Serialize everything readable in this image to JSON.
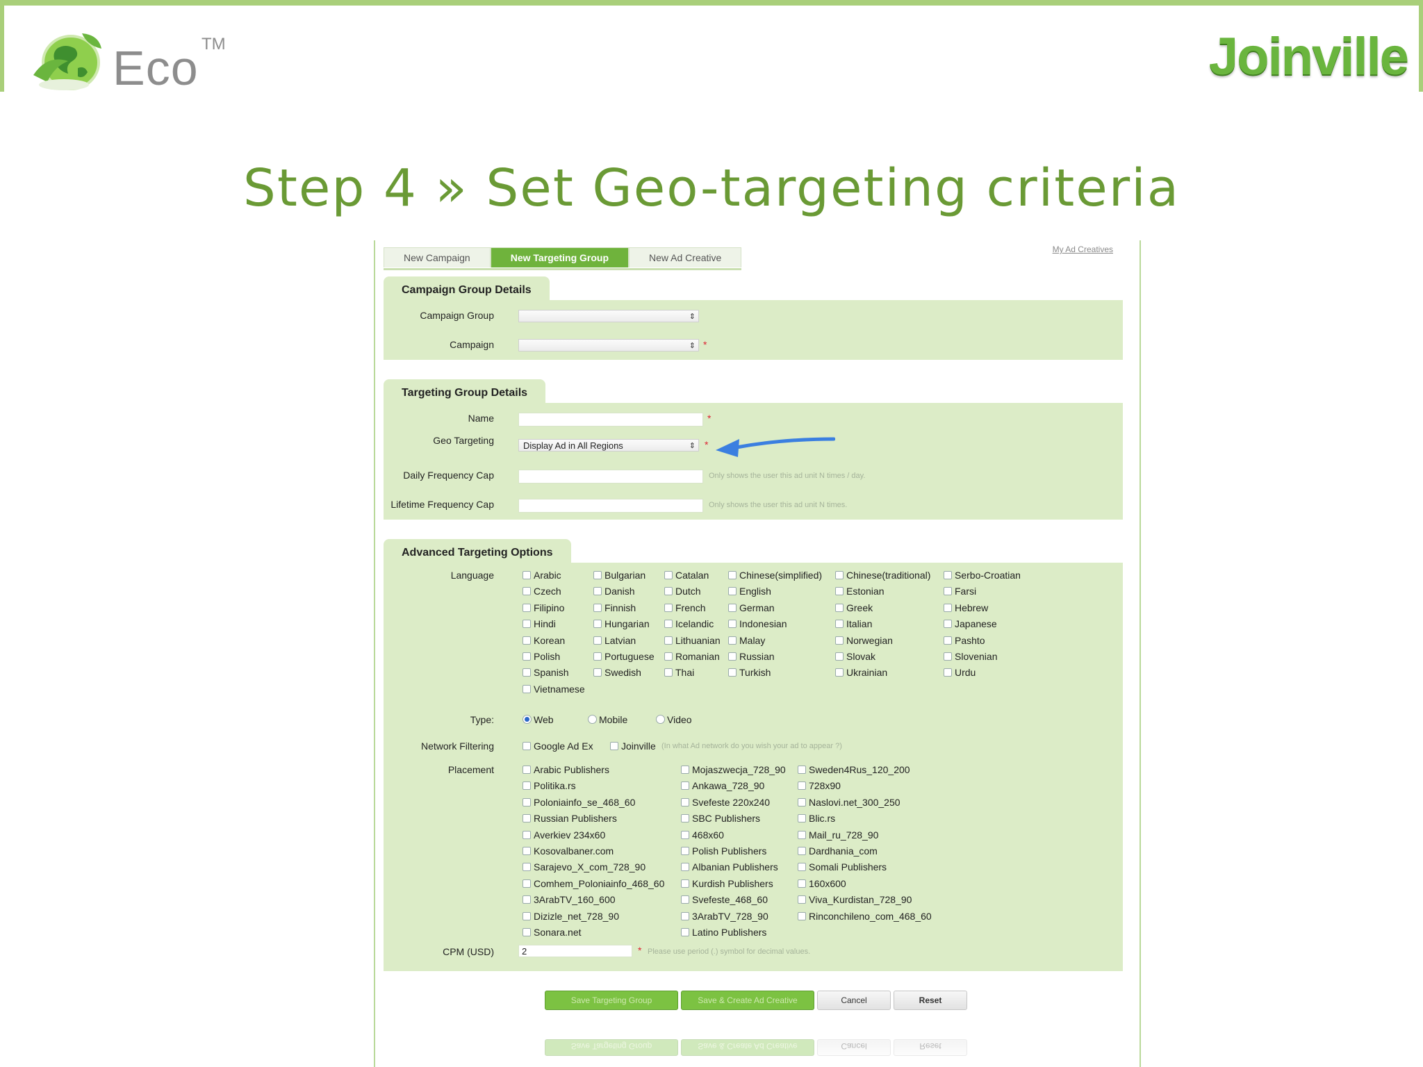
{
  "slide": {
    "eco_brand": "Eco",
    "eco_tm": "TM",
    "joinville_brand": "Joinville",
    "title": "Step 4 » Set Geo-targeting criteria"
  },
  "colors": {
    "accent_green": "#6a9a35",
    "panel_green": "#dcecc7",
    "tab_active": "#6fb33c",
    "arrow_blue": "#3b7fe0"
  },
  "tabs": [
    {
      "label": "New Campaign"
    },
    {
      "label": "New Targeting Group",
      "active": true
    },
    {
      "label": "New Ad Creative"
    }
  ],
  "top_links": {
    "my_ad_creatives": "My Ad Creatives"
  },
  "campaign_group_details": {
    "heading": "Campaign Group Details",
    "campaign_group_label": "Campaign Group",
    "campaign_label": "Campaign"
  },
  "targeting_group_details": {
    "heading": "Targeting Group Details",
    "name_label": "Name",
    "geo_label": "Geo Targeting",
    "geo_value": "Display Ad in All Regions",
    "daily_cap_label": "Daily Frequency Cap",
    "daily_cap_hint": "Only shows the user this ad unit N times / day.",
    "lifetime_cap_label": "Lifetime Frequency Cap",
    "lifetime_cap_hint": "Only shows the user this ad unit N times."
  },
  "advanced": {
    "heading": "Advanced Targeting Options",
    "language_label": "Language",
    "languages": [
      [
        "Arabic",
        "Bulgarian",
        "Catalan",
        "Chinese(simplified)",
        "Chinese(traditional)",
        "Serbo-Croatian"
      ],
      [
        "Czech",
        "Danish",
        "Dutch",
        "English",
        "Estonian",
        "Farsi"
      ],
      [
        "Filipino",
        "Finnish",
        "French",
        "German",
        "Greek",
        "Hebrew"
      ],
      [
        "Hindi",
        "Hungarian",
        "Icelandic",
        "Indonesian",
        "Italian",
        "Japanese"
      ],
      [
        "Korean",
        "Latvian",
        "Lithuanian",
        "Malay",
        "Norwegian",
        "Pashto"
      ],
      [
        "Polish",
        "Portuguese",
        "Romanian",
        "Russian",
        "Slovak",
        "Slovenian"
      ],
      [
        "Spanish",
        "Swedish",
        "Thai",
        "Turkish",
        "Ukrainian",
        "Urdu"
      ],
      [
        "Vietnamese"
      ]
    ],
    "type_label": "Type:",
    "types": [
      {
        "label": "Web",
        "selected": true
      },
      {
        "label": "Mobile",
        "selected": false
      },
      {
        "label": "Video",
        "selected": false
      }
    ],
    "network_label": "Network Filtering",
    "networks": [
      "Google Ad Ex",
      "Joinville"
    ],
    "network_hint": "(In what Ad network do you wish your ad to appear ?)",
    "placement_label": "Placement",
    "placements": [
      [
        "Arabic Publishers",
        "Mojaszwecja_728_90",
        "Sweden4Rus_120_200"
      ],
      [
        "Politika.rs",
        "Ankawa_728_90",
        "728x90"
      ],
      [
        "Poloniainfo_se_468_60",
        "Svefeste 220x240",
        "Naslovi.net_300_250"
      ],
      [
        "Russian Publishers",
        "SBC Publishers",
        "Blic.rs"
      ],
      [
        "Averkiev 234x60",
        "468x60",
        "Mail_ru_728_90"
      ],
      [
        "Kosovalbaner.com",
        "Polish Publishers",
        "Dardhania_com"
      ],
      [
        "Sarajevo_X_com_728_90",
        "Albanian Publishers",
        "Somali Publishers"
      ],
      [
        "Comhem_Poloniainfo_468_60",
        "Kurdish Publishers",
        "160x600"
      ],
      [
        "3ArabTV_160_600",
        "Svefeste_468_60",
        "Viva_Kurdistan_728_90"
      ],
      [
        "Dizizle_net_728_90",
        "3ArabTV_728_90",
        "Rinconchileno_com_468_60"
      ],
      [
        "Sonara.net",
        "Latino Publishers"
      ]
    ],
    "cpm_label": "CPM  (USD)",
    "cpm_value": "2",
    "cpm_hint": "Please use period (.) symbol for decimal values."
  },
  "buttons": {
    "save_targeting": "Save Targeting Group",
    "save_create": "Save & Create Ad Creative",
    "cancel": "Cancel",
    "reset": "Reset"
  }
}
